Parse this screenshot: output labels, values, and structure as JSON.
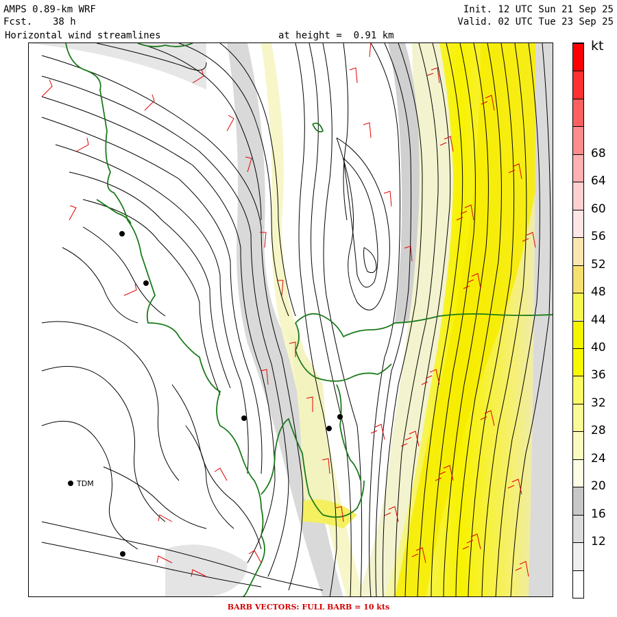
{
  "header": {
    "model": "AMPS 0.89-km WRF",
    "forecast_label": "Fcst.",
    "forecast_value": "38 h",
    "field": "Horizontal wind streamlines",
    "height": "at height =  0.91 km",
    "init": "Init. 12 UTC Sun 21 Sep 25",
    "valid": "Valid. 02 UTC Tue 23 Sep 25"
  },
  "colorbar": {
    "unit": "kt",
    "labels": [
      "12",
      "16",
      "20",
      "24",
      "28",
      "32",
      "36",
      "40",
      "44",
      "48",
      "52",
      "56",
      "60",
      "64",
      "68"
    ],
    "colors": [
      "#ffffff",
      "#efefef",
      "#dcdcdc",
      "#c8c8c8",
      "#fdfde4",
      "#fbfbc0",
      "#fafa96",
      "#fafa64",
      "#f8f800",
      "#f5f500",
      "#f6f650",
      "#f7e070",
      "#fce6b0",
      "#ffe6e6",
      "#ffd0d0",
      "#ffb0b0",
      "#ff8c8c",
      "#ff6060",
      "#ff3030",
      "#ff0000"
    ]
  },
  "stations": [
    {
      "label": "TDM"
    }
  ],
  "footer": "BARB VECTORS:  FULL BARB = 10 kts"
}
